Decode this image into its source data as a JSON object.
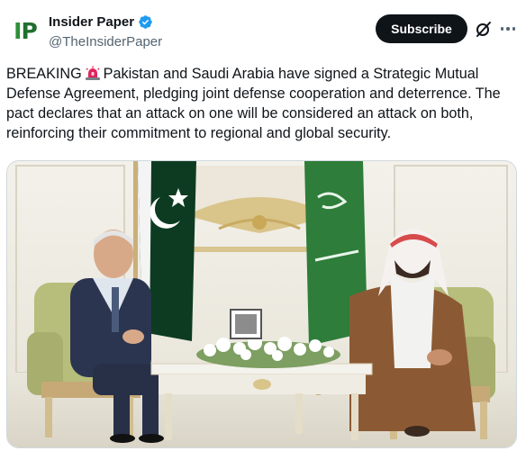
{
  "header": {
    "avatar_logo": "IP",
    "display_name": "Insider Paper",
    "handle": "@TheInsiderPaper",
    "subscribe_label": "Subscribe"
  },
  "icons": {
    "verified": "verified-badge-icon",
    "grok": "grok-icon",
    "more": "more-options-icon",
    "siren": "rotating-light-icon"
  },
  "colors": {
    "verified_blue": "#1d9bf0",
    "subscribe_bg": "#0f1419",
    "handle_gray": "#536471",
    "brand_green": "#2f8f3a"
  },
  "tweet": {
    "text_prefix": "BREAKING",
    "text_body": "Pakistan and Saudi Arabia have signed a Strategic Mutual Defense Agreement, pledging joint defense cooperation and deterrence. The pact declares that an attack on one will be considered an attack on both, reinforcing their commitment to regional and global security."
  },
  "media": {
    "kind": "photo",
    "scene": "two-leaders-seated-with-flags"
  }
}
